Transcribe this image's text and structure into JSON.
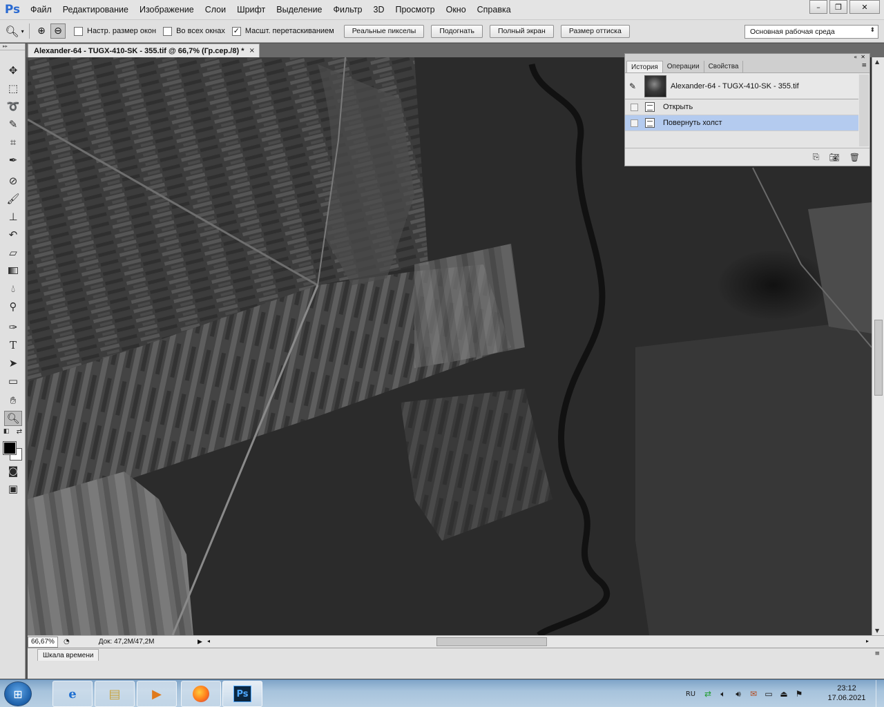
{
  "app": {
    "logo": "Ps",
    "menu": [
      "Файл",
      "Редактирование",
      "Изображение",
      "Слои",
      "Шрифт",
      "Выделение",
      "Фильтр",
      "3D",
      "Просмотр",
      "Окно",
      "Справка"
    ],
    "window_controls": {
      "minimize": "–",
      "restore": "❐",
      "close": "✕"
    }
  },
  "options_bar": {
    "tool_icon": "zoom-icon",
    "checkboxes": [
      {
        "label": "Настр. размер окон",
        "checked": false
      },
      {
        "label": "Во всех окнах",
        "checked": false
      },
      {
        "label": "Масшт. перетаскиванием",
        "checked": true
      }
    ],
    "buttons": [
      "Реальные пикселы",
      "Подогнать",
      "Полный экран",
      "Размер оттиска"
    ],
    "workspace": "Основная рабочая среда"
  },
  "document": {
    "tab_title": "Alexander-64 - TUGX-410-SK - 355.tif @ 66,7% (Гр.сер./8) *",
    "close": "×"
  },
  "status": {
    "zoom": "66,67%",
    "doc_info": "Док: 47,2M/47,2M"
  },
  "timeline": {
    "tab": "Шкала времени"
  },
  "history_panel": {
    "tabs": [
      "История",
      "Операции",
      "Свойства"
    ],
    "snapshot_name": "Alexander-64 - TUGX-410-SK - 355.tif",
    "steps": [
      {
        "label": "Открыть",
        "selected": false
      },
      {
        "label": "Повернуть холст",
        "selected": true
      }
    ]
  },
  "taskbar": {
    "apps": [
      "internet-explorer-icon",
      "file-explorer-icon",
      "media-player-icon",
      "firefox-icon",
      "photoshop-icon"
    ],
    "ps_label": "Ps",
    "language": "RU",
    "time": "23:12",
    "date": "17.06.2021"
  },
  "colors": {
    "selection": "#b4cbef",
    "ps_blue": "#2a6ad1",
    "canvas_dark": "#2a2a2a"
  }
}
